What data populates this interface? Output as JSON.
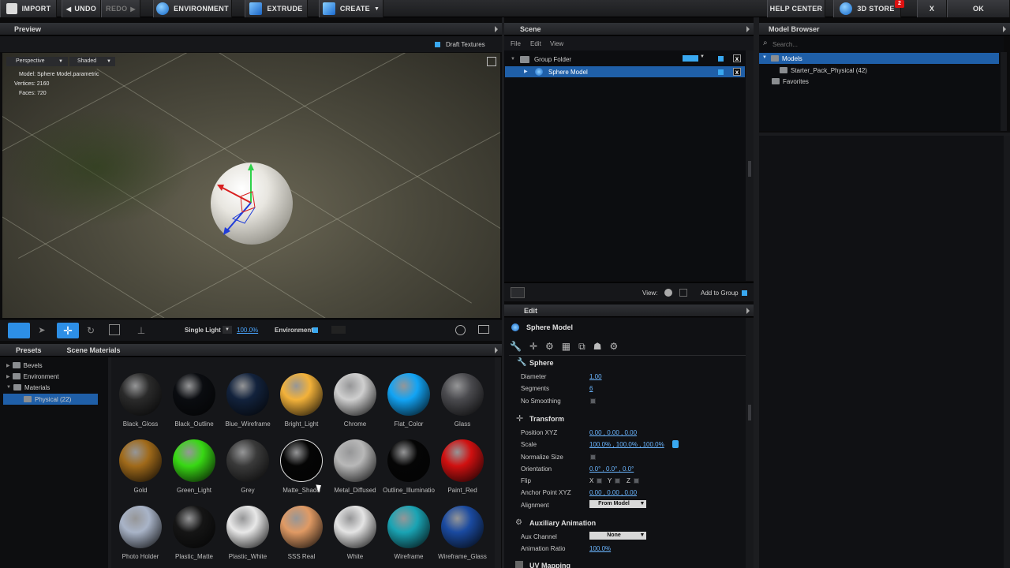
{
  "toolbar": {
    "import": "IMPORT",
    "undo": "UNDO",
    "redo": "REDO",
    "environment": "ENVIRONMENT",
    "extrude": "EXTRUDE",
    "create": "CREATE",
    "help_center": "HELP CENTER",
    "store": "3D STORE",
    "store_badge": "2",
    "close": "X",
    "ok": "OK"
  },
  "preview": {
    "title": "Preview",
    "draft_textures": "Draft Textures",
    "camera": "Perspective",
    "shading": "Shaded",
    "info": {
      "model": "Model:  Sphere Model.parametric",
      "vertices": "Vertices:  2160",
      "faces": "Faces:  720"
    },
    "light": "Single Light",
    "light_pct": "100.0%",
    "environment_label": "Environment"
  },
  "materials_panel": {
    "tab_presets": "Presets",
    "tab_scene_materials": "Scene Materials",
    "tree": [
      {
        "label": "Bevels"
      },
      {
        "label": "Environment"
      },
      {
        "label": "Materials"
      },
      {
        "label": "Physical (22)"
      }
    ],
    "materials": [
      {
        "name": "Black_Gloss",
        "color": "#2a2a2a"
      },
      {
        "name": "Black_Outline",
        "color": "#0a0c10"
      },
      {
        "name": "Blue_Wireframe",
        "color": "#12223c"
      },
      {
        "name": "Bright_Light",
        "color": "#f3b23a"
      },
      {
        "name": "Chrome",
        "color": "#cfcfcf"
      },
      {
        "name": "Flat_Color",
        "color": "#12a4f5"
      },
      {
        "name": "Glass",
        "color": "#4a4a4e"
      },
      {
        "name": "Gold",
        "color": "#a06a1a"
      },
      {
        "name": "Green_Light",
        "color": "#38d814"
      },
      {
        "name": "Grey",
        "color": "#3a3a3a"
      },
      {
        "name": "Matte_Shado",
        "color": "#050505"
      },
      {
        "name": "Metal_Diffused",
        "color": "#b8b8b8"
      },
      {
        "name": "Outline_Illuminatio",
        "color": "#050505"
      },
      {
        "name": "Paint_Red",
        "color": "#d01010"
      },
      {
        "name": "Photo Holder",
        "color": "#a9b4c8"
      },
      {
        "name": "Plastic_Matte",
        "color": "#151515"
      },
      {
        "name": "Plastic_White",
        "color": "#e8e8e8"
      },
      {
        "name": "SSS Real",
        "color": "#e09a64"
      },
      {
        "name": "White",
        "color": "#e4e4e4"
      },
      {
        "name": "Wireframe",
        "color": "#1aa4b4"
      },
      {
        "name": "Wireframe_Glass",
        "color": "#1a4aa0"
      }
    ]
  },
  "scene": {
    "title": "Scene",
    "menu": [
      "File",
      "Edit",
      "View"
    ],
    "items": [
      {
        "label": "Group Folder"
      },
      {
        "label": "Sphere Model"
      }
    ],
    "view_label": "View:",
    "add_to_group": "Add to Group"
  },
  "model_browser": {
    "title": "Model Browser",
    "search_placeholder": "Search...",
    "items": [
      {
        "label": "Models"
      },
      {
        "label": "Starter_Pack_Physical (42)"
      },
      {
        "label": "Favorites"
      }
    ]
  },
  "edit": {
    "title": "Edit",
    "object_name": "Sphere Model",
    "sphere": {
      "title": "Sphere",
      "diameter_label": "Diameter",
      "diameter": "1.00",
      "segments_label": "Segments",
      "segments": "6",
      "no_smoothing_label": "No Smoothing"
    },
    "transform": {
      "title": "Transform",
      "position_label": "Position XYZ",
      "position": "0.00 ,  0.00 ,  0.00",
      "scale_label": "Scale",
      "scale": "100.0% ,  100.0% ,  100.0%",
      "normalize_label": "Normalize Size",
      "orientation_label": "Orientation",
      "orientation": "0.0° ,  0.0° ,  0.0°",
      "flip_label": "Flip",
      "flip_axes": [
        "X",
        "Y",
        "Z"
      ],
      "anchor_label": "Anchor Point XYZ",
      "anchor": "0.00 ,  0.00 ,  0.00",
      "alignment_label": "Alignment",
      "alignment": "From Model"
    },
    "aux": {
      "title": "Auxiliary Animation",
      "channel_label": "Aux Channel",
      "channel": "None",
      "ratio_label": "Animation Ratio",
      "ratio": "100.0%"
    },
    "uv_title": "UV Mapping"
  },
  "colors": {
    "accent": "#2d8fe6",
    "selection": "#1f5fa8"
  }
}
